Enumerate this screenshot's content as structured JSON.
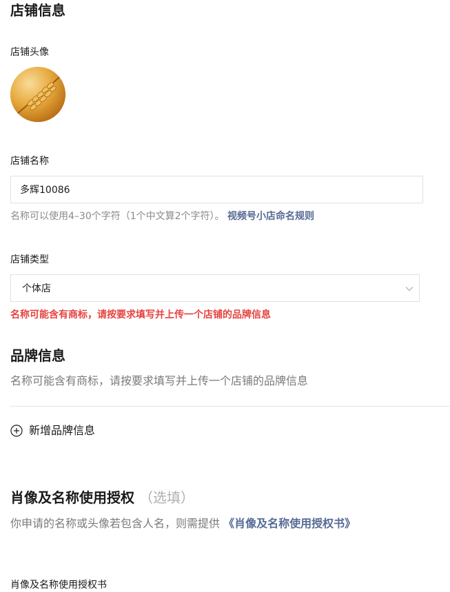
{
  "store_info": {
    "heading": "店铺信息",
    "avatar_label": "店铺头像",
    "name_label": "店铺名称",
    "name_value": "多辉10086",
    "name_hint": "名称可以使用4–30个字符（1个中文算2个字符）。",
    "name_rule_link": "视频号小店命名规则",
    "type_label": "店铺类型",
    "type_value": "个体店",
    "type_error": "名称可能含有商标，请按要求填写并上传一个店铺的品牌信息"
  },
  "brand_info": {
    "heading": "品牌信息",
    "description": "名称可能含有商标，请按要求填写并上传一个店铺的品牌信息",
    "add_label": "新增品牌信息"
  },
  "authorization": {
    "heading": "肖像及名称使用授权",
    "optional": "（选填）",
    "description": "你申请的名称或头像若包含人名，则需提供",
    "doc_link": "《肖像及名称使用授权书》",
    "doc_label": "肖像及名称使用授权书"
  },
  "icons": {
    "avatar": "wheat-image",
    "select_arrow": "chevron-down-icon",
    "add": "plus-circle-icon"
  }
}
